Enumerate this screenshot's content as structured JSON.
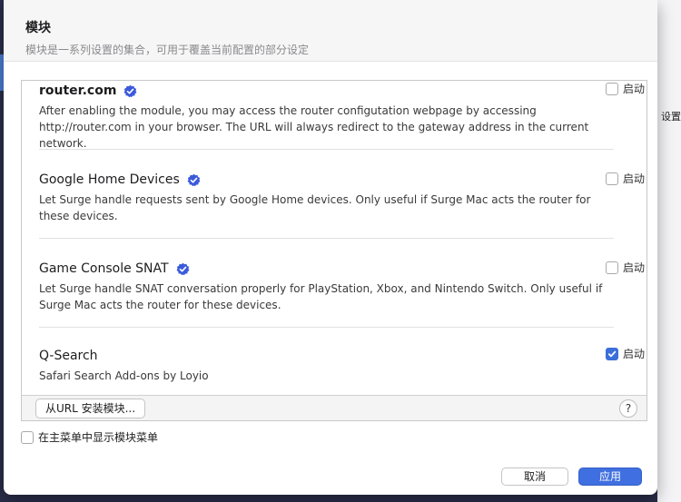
{
  "background": {
    "side_text": "设置"
  },
  "sheet": {
    "title": "模块",
    "subtitle": "模块是一系列设置的集合，可用于覆盖当前配置的部分设定"
  },
  "modules": [
    {
      "name": "router.com",
      "verified": true,
      "description": "After enabling the module, you may access the router configutation webpage by accessing http://router.com in your browser. The URL will always redirect to the gateway address in the current network.",
      "enabled": false,
      "enable_label": "启动"
    },
    {
      "name": "Google Home Devices",
      "verified": true,
      "description": "Let Surge handle requests sent by Google Home devices. Only useful if Surge Mac acts the router for these devices.",
      "enabled": false,
      "enable_label": "启动"
    },
    {
      "name": "Game Console SNAT",
      "verified": true,
      "description": "Let Surge handle SNAT conversation properly for PlayStation, Xbox, and Nintendo Switch. Only useful if Surge Mac acts the router for these devices.",
      "enabled": false,
      "enable_label": "启动"
    },
    {
      "name": "Q-Search",
      "verified": false,
      "description": "Safari Search Add-ons by Loyio",
      "enabled": true,
      "enable_label": "启动"
    }
  ],
  "footer": {
    "install_label": "从URL 安装模块...",
    "help_label": "?"
  },
  "options": {
    "show_in_menu_label": "在主菜单中显示模块菜单",
    "show_in_menu_checked": false
  },
  "actions": {
    "cancel_label": "取消",
    "apply_label": "应用"
  },
  "colors": {
    "accent": "#3f6fe0",
    "verified_badge": "#3b5bdb"
  }
}
